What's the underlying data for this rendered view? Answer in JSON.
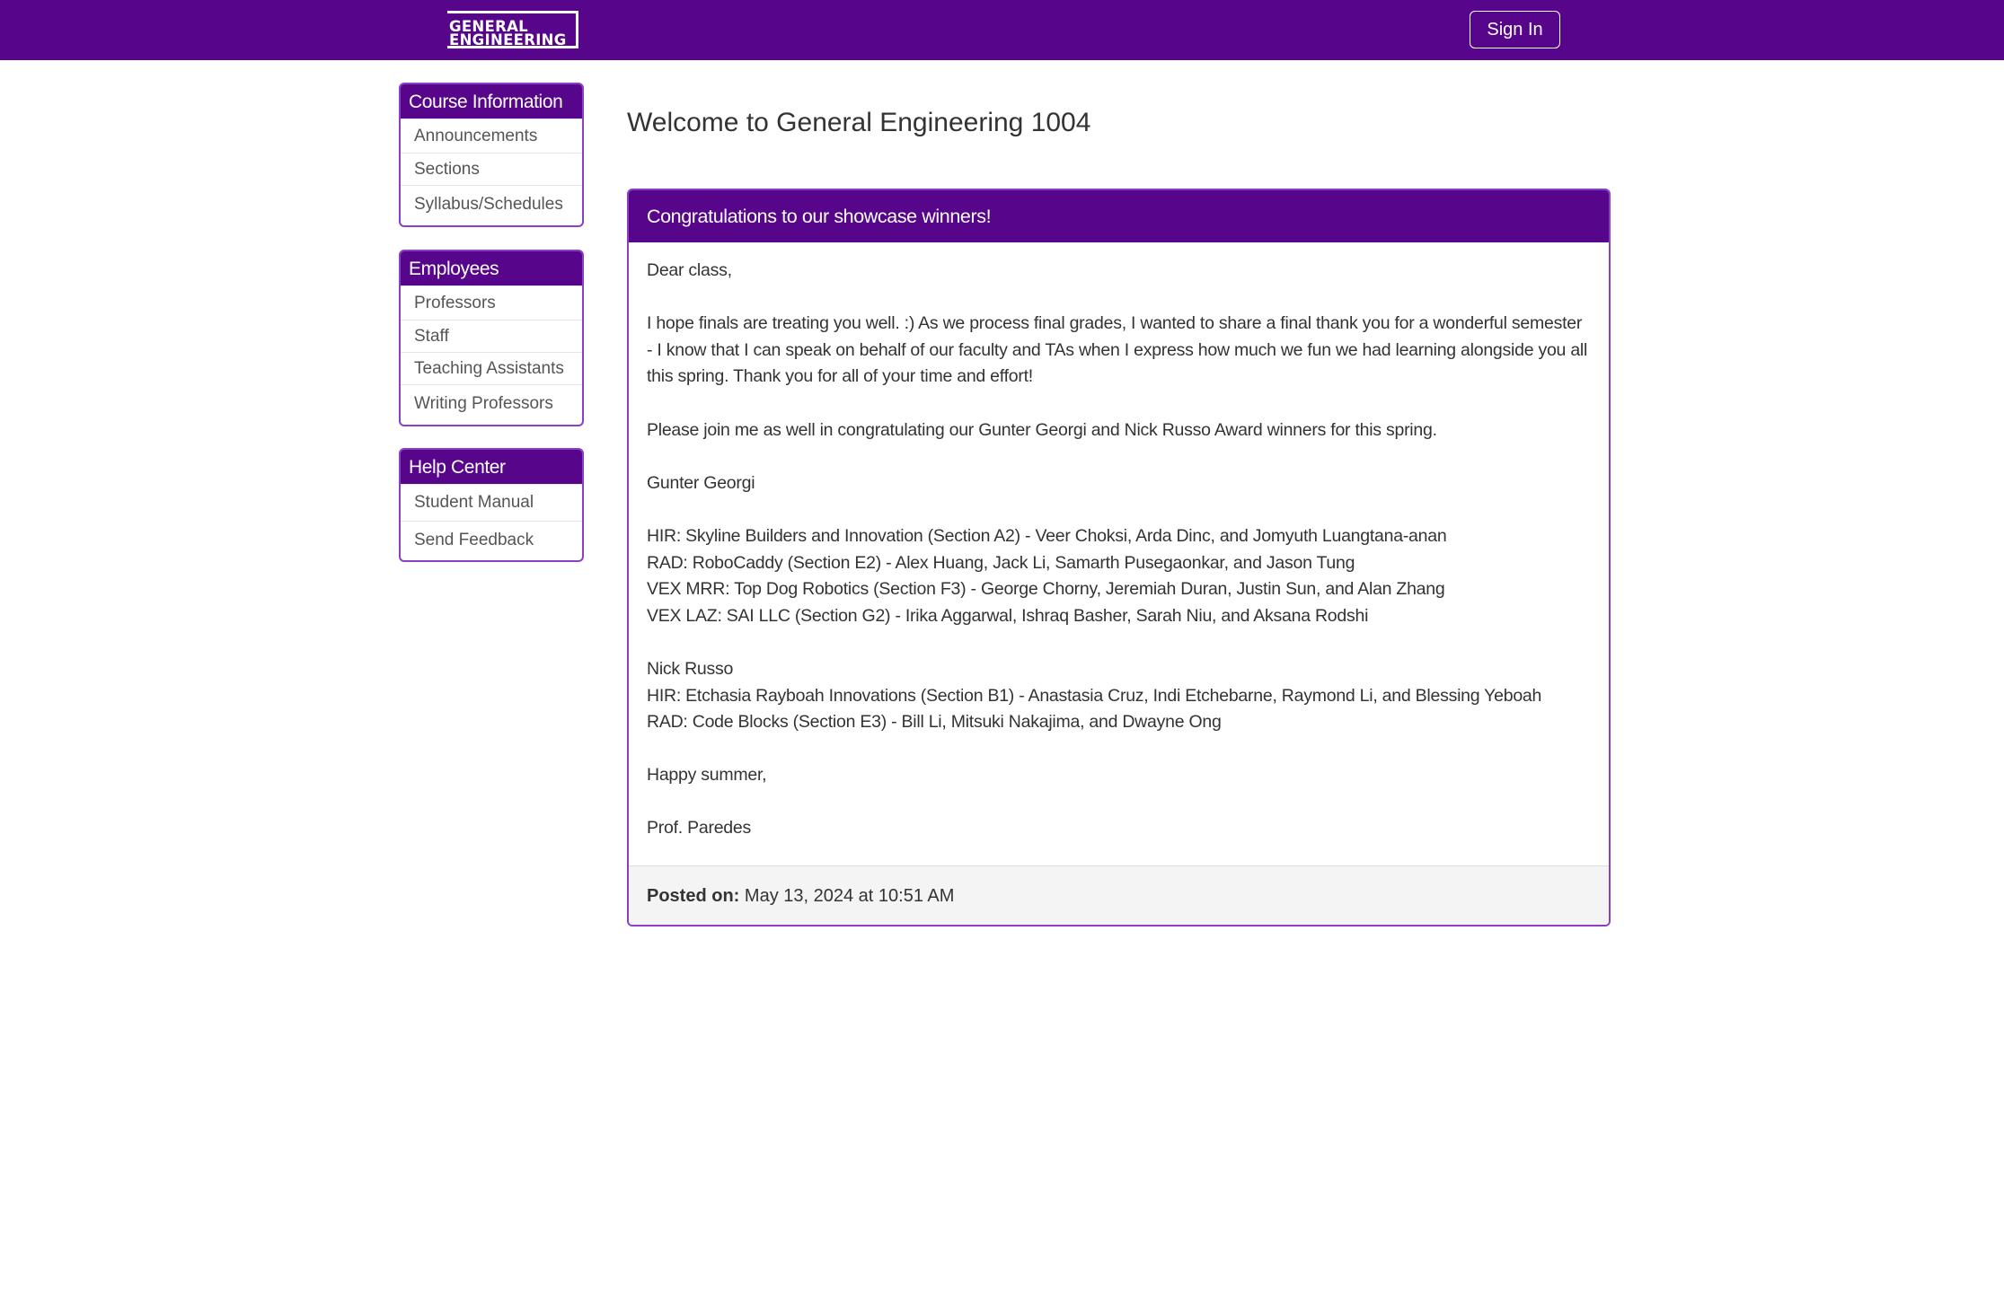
{
  "header": {
    "logo_line1": "GENERAL",
    "logo_line2": "ENGINEERING",
    "signin_label": "Sign In"
  },
  "sidebar": {
    "course_info": {
      "title": "Course Information",
      "items": [
        "Announcements",
        "Sections",
        "Syllabus/Schedules"
      ]
    },
    "employees": {
      "title": "Employees",
      "items": [
        "Professors",
        "Staff",
        "Teaching Assistants",
        "Writing Professors"
      ]
    },
    "help_center": {
      "title": "Help Center",
      "items": [
        "Student Manual",
        "Send Feedback"
      ]
    }
  },
  "main": {
    "title": "Welcome to General Engineering 1004",
    "announcement": {
      "title": "Congratulations to our showcase winners!",
      "greeting": "Dear class,",
      "paragraph1": "I hope finals are treating you well. :) As we process final grades, I wanted to share a final thank you for a wonderful semester - I know that I can speak on behalf of our faculty and TAs when I express how much we fun we had learning alongside you all this spring. Thank you for all of your time and effort!",
      "paragraph2": "Please join me as well in congratulating our Gunter Georgi and Nick Russo Award winners for this spring.",
      "award1_name": "Gunter Georgi",
      "award1_winners": [
        "HIR: Skyline Builders and Innovation (Section A2) - Veer Choksi, Arda Dinc, and Jomyuth Luangtana-anan",
        "RAD: RoboCaddy (Section E2) - Alex Huang, Jack Li, Samarth Pusegaonkar, and Jason Tung",
        "VEX MRR: Top Dog Robotics (Section F3) - George Chorny, Jeremiah Duran, Justin Sun, and Alan Zhang",
        "VEX LAZ: SAI LLC (Section G2) - Irika Aggarwal, Ishraq Basher, Sarah Niu, and Aksana Rodshi"
      ],
      "award2_name": "Nick Russo",
      "award2_winners": [
        "HIR: Etchasia Rayboah Innovations (Section B1) - Anastasia Cruz, Indi Etchebarne, Raymond Li, and Blessing Yeboah",
        "RAD: Code Blocks (Section E3) - Bill Li, Mitsuki Nakajima, and Dwayne Ong"
      ],
      "closing": "Happy summer,",
      "signature": "Prof. Paredes",
      "posted_label": "Posted on:",
      "posted_date": "May 13, 2024 at 10:51 AM"
    }
  },
  "colors": {
    "brand_purple": "#57068c",
    "panel_border": "#8a3fc7",
    "footer_bg": "#f4f4f4"
  }
}
